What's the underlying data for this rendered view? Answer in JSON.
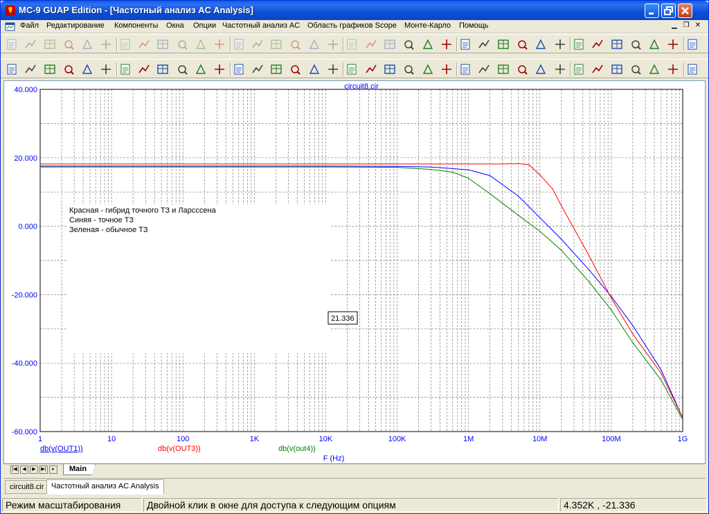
{
  "window": {
    "title": "MC-9 GUAP Edition - [Частотный анализ AC Analysis]",
    "title_color": "#ffffff",
    "accent": "#0a5fe6"
  },
  "menu": [
    {
      "label": "Файл",
      "u": "Ф"
    },
    {
      "label": "Редактирование",
      "u": "Р"
    },
    {
      "label": "Компоненты",
      "u": ""
    },
    {
      "label": "Окна",
      "u": "О"
    },
    {
      "label": "Опции",
      "u": "О"
    },
    {
      "label": "Частотный анализ AC",
      "u": ""
    },
    {
      "label": "Область графиков Scope",
      "u": ""
    },
    {
      "label": "Монте-Карло",
      "u": ""
    },
    {
      "label": "Помощь",
      "u": "П"
    }
  ],
  "toolbar1_icons": [
    "new-icon",
    "open-icon",
    "save-icon",
    "save-all-icon",
    "print-icon",
    "print-preview-icon",
    "undo-icon",
    "redo-icon",
    "cut-icon",
    "copy-icon",
    "paste-icon",
    "delete-icon",
    "component-icon",
    "ground-icon",
    "resistor-icon",
    "capacitor-icon",
    "inductor-icon",
    "diode-icon",
    "transistor-icon",
    "battery-icon",
    "opamp-icon",
    "tile-horizontal-icon",
    "tile-vertical-icon",
    "cascade-icon",
    "window-icon",
    "split-icon",
    "calculator-icon",
    "text-p-icon",
    "text-g-icon",
    "table-icon",
    "grid-icon",
    "wave-icon",
    "wire-icon",
    "probe-icon",
    "analysis-icon",
    "vd-icon",
    "scope-icon"
  ],
  "toolbar2_icons": [
    "select-arrow-icon",
    "shape-icon",
    "waveform-icon",
    "measure-icon",
    "cursor-icon",
    "slope-icon",
    "label-icon",
    "text-icon",
    "run-icon",
    "stop-icon",
    "pause-icon",
    "line-icon",
    "diag-icon",
    "grid-icon",
    "grid2-icon",
    "grid3-icon",
    "peak-icon",
    "valley-icon",
    "high-icon",
    "low-icon",
    "plot-icon",
    "cursor-left-icon",
    "cursor-right-icon",
    "peak2-icon",
    "valley2-icon",
    "hi-icon",
    "lo-icon",
    "inflect-icon",
    "global-hi-icon",
    "global-lo-icon",
    "slope2-icon",
    "export-icon",
    "table2-icon",
    "data-icon",
    "scale-icon",
    "zoom-in-icon",
    "zoom-out-icon"
  ],
  "chart_data": {
    "type": "line",
    "title": "circuit8.cir",
    "xlabel": "F (Hz)",
    "xscale": "log",
    "xlim": [
      1,
      1000000000
    ],
    "ylim": [
      -60,
      40
    ],
    "x_ticks": [
      "1",
      "10",
      "100",
      "1K",
      "10K",
      "100K",
      "1M",
      "10M",
      "100M",
      "1G"
    ],
    "y_ticks": [
      "40.000",
      "20.000",
      "0.000",
      "-20.000",
      "-40.000",
      "-60.000"
    ],
    "grid": true,
    "annotations": [
      "Красная - гибрид точного ТЗ и Ларсссена",
      "Синяя - точное ТЗ",
      "Зеленая - обычное ТЗ"
    ],
    "cursor_value": "21.336",
    "series": [
      {
        "name": "db(v(OUT1))",
        "color": "#0000ff",
        "x": [
          1,
          10000,
          100000,
          300000,
          1000000,
          2000000,
          5000000,
          10000000,
          20000000,
          50000000,
          100000000,
          200000000,
          500000000,
          1000000000
        ],
        "y": [
          17.6,
          17.6,
          17.5,
          17.3,
          16.5,
          14.8,
          8.8,
          2.5,
          -3.8,
          -13.0,
          -20.5,
          -29.0,
          -42.0,
          -56.0
        ]
      },
      {
        "name": "db(v(OUT3))",
        "color": "#ff0000",
        "x": [
          1,
          10000,
          100000,
          1000000,
          3000000,
          5000000,
          7000000,
          10000000,
          15000000,
          20000000,
          50000000,
          100000000,
          200000000,
          500000000,
          1000000000
        ],
        "y": [
          18.2,
          18.2,
          18.2,
          18.2,
          18.2,
          18.3,
          18.0,
          15.0,
          11.0,
          6.0,
          -9.0,
          -21.0,
          -31.5,
          -43.0,
          -56.0
        ]
      },
      {
        "name": "db(v(out4))",
        "color": "#008000",
        "x": [
          1,
          10000,
          100000,
          300000,
          600000,
          1000000,
          2000000,
          5000000,
          10000000,
          20000000,
          50000000,
          100000000,
          200000000,
          500000000,
          1000000000
        ],
        "y": [
          17.3,
          17.3,
          17.2,
          16.6,
          15.8,
          14.0,
          9.5,
          3.2,
          -1.5,
          -7.0,
          -16.5,
          -24.5,
          -34.0,
          -45.0,
          -56.5
        ]
      }
    ]
  },
  "axis_color": "#0000ff",
  "bottom_tabs": {
    "main": "Main"
  },
  "doc_tabs": [
    "circuit8.cir",
    "Частотный анализ AC Analysis"
  ],
  "status": {
    "mode": "Режим масштабирования",
    "hint": "Двойной клик в окне для доступа к следующим опциям",
    "coords": "4.352K , -21.336"
  }
}
